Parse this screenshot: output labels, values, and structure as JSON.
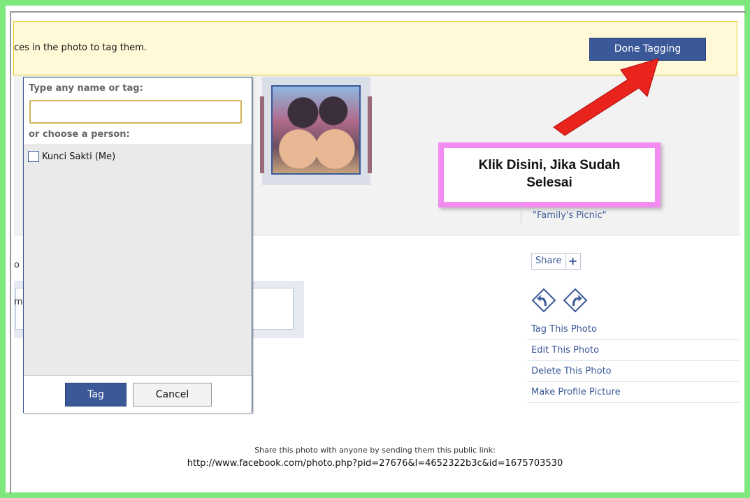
{
  "notice": {
    "text": "ces in the photo to tag them.",
    "done_button": "Done Tagging"
  },
  "callout": {
    "line1": "Klik Disini, Jika Sudah",
    "line2": "Selesai"
  },
  "album": {
    "link": "\"Family's Picnic\""
  },
  "left_fragments": {
    "frag1": "o",
    "frag2": "m"
  },
  "share": {
    "label": "Share",
    "plus": "+"
  },
  "actions": [
    {
      "label": "Tag This Photo"
    },
    {
      "label": "Edit This Photo"
    },
    {
      "label": "Delete This Photo"
    },
    {
      "label": "Make Profile Picture"
    }
  ],
  "footer": {
    "line1": "Share this photo with anyone by sending them this public link:",
    "line2": "http://www.facebook.com/photo.php?pid=27676&l=4652322b3c&id=1675703530"
  },
  "tagger": {
    "heading": "Type any name or tag:",
    "input_value": "",
    "sub_heading": "or choose a person:",
    "people": [
      {
        "name": "Kunci Sakti (Me)",
        "checked": false
      }
    ],
    "tag_button": "Tag",
    "cancel_button": "Cancel"
  },
  "colors": {
    "brand": "#3b5998",
    "notice_bg": "#fff9d7",
    "frame": "#7ee87e",
    "callout_border": "#f28cf0",
    "arrow": "#e8241c"
  }
}
